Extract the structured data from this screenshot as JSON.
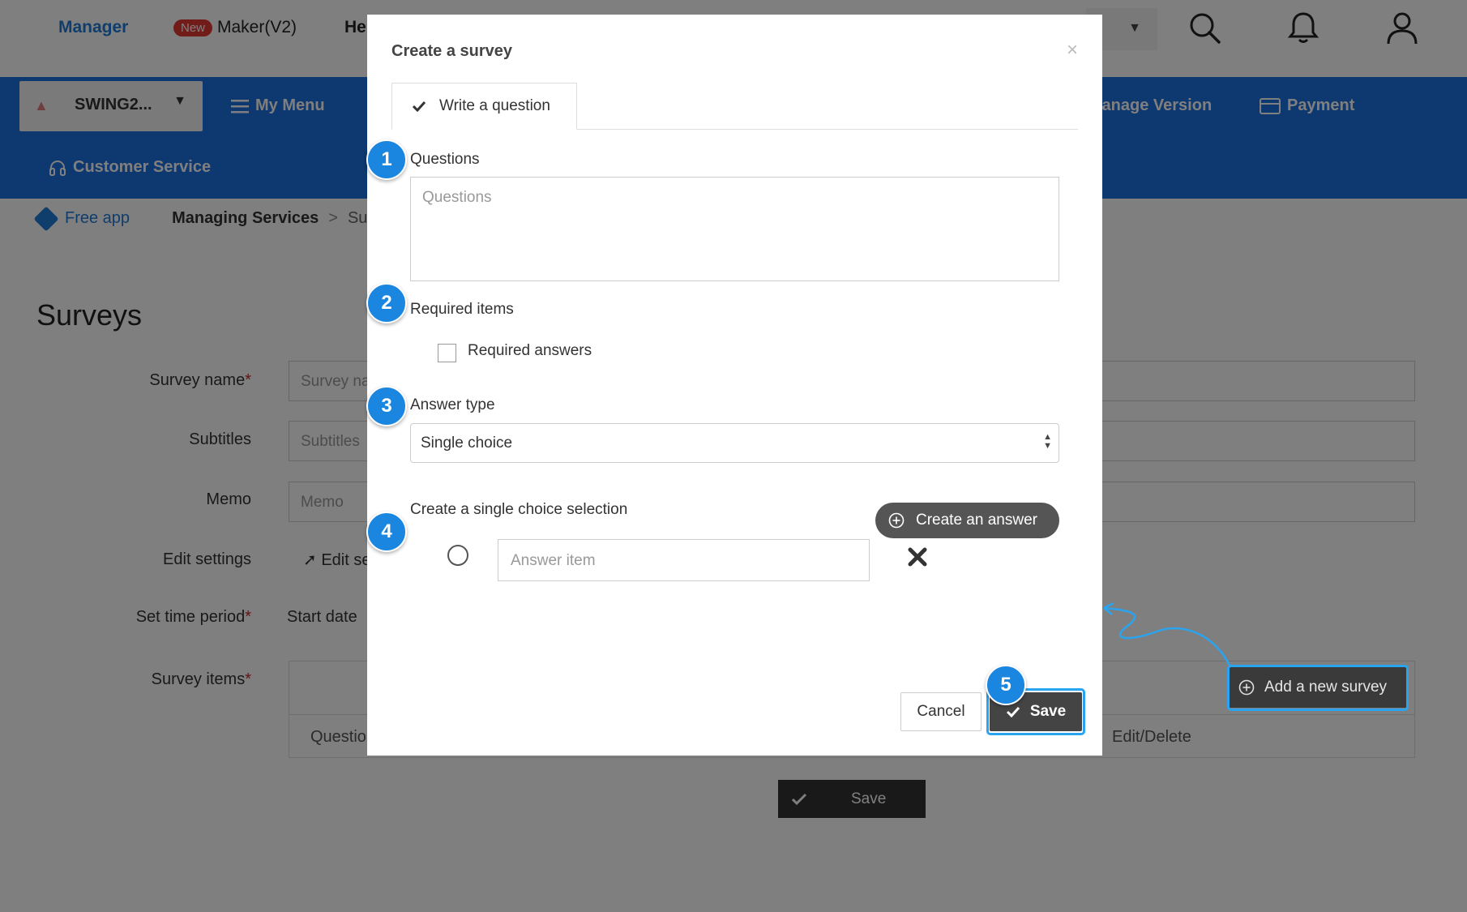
{
  "topbar": {
    "manager_label": "Manager",
    "new_badge": "New",
    "maker_label": "Maker(V2)",
    "help_label": "He"
  },
  "bluebar": {
    "app_name": "SWING2...",
    "my_menu": "My Menu",
    "manage_version": "lanage Version",
    "payment": "Payment",
    "customer_service": "Customer Service"
  },
  "breadcrumb": {
    "free_app": "Free app",
    "managing_services": "Managing Services",
    "separator": ">",
    "current": "Surv"
  },
  "page": {
    "title": "Surveys",
    "survey_name_label": "Survey name",
    "survey_name_placeholder": "Survey na",
    "subtitles_label": "Subtitles",
    "subtitles_placeholder": "Subtitles",
    "memo_label": "Memo",
    "memo_placeholder": "Memo",
    "edit_settings_label": "Edit settings",
    "edit_settings_link": "Edit se",
    "set_time_period_label": "Set time period",
    "start_date": "Start date",
    "survey_items_label": "Survey items",
    "required_mark": "*",
    "col_question": "Questio",
    "col_edit_delete": "Edit/Delete",
    "add_new_survey": "Add a new survey",
    "save": "Save"
  },
  "modal": {
    "title": "Create a survey",
    "close": "×",
    "tab_label": "Write a question",
    "questions_label": "Questions",
    "questions_placeholder": "Questions",
    "required_items_label": "Required items",
    "required_answers_label": "Required answers",
    "answer_type_label": "Answer type",
    "answer_type_value": "Single choice",
    "single_choice_label": "Create a single choice selection",
    "create_answer_label": "Create an answer",
    "answer_item_placeholder": "Answer item",
    "cancel_label": "Cancel",
    "save_label": "Save"
  },
  "steps": [
    "1",
    "2",
    "3",
    "4",
    "5"
  ],
  "colors": {
    "brand_blue": "#1d70e0",
    "step_badge": "#1a86e0",
    "highlight": "#2aa4ef"
  },
  "icons": [
    "search-icon",
    "bell-icon",
    "user-icon",
    "menu-icon",
    "card-icon",
    "headset-icon",
    "check-icon",
    "plus-circle-icon",
    "close-icon",
    "delete-icon",
    "send-icon"
  ]
}
